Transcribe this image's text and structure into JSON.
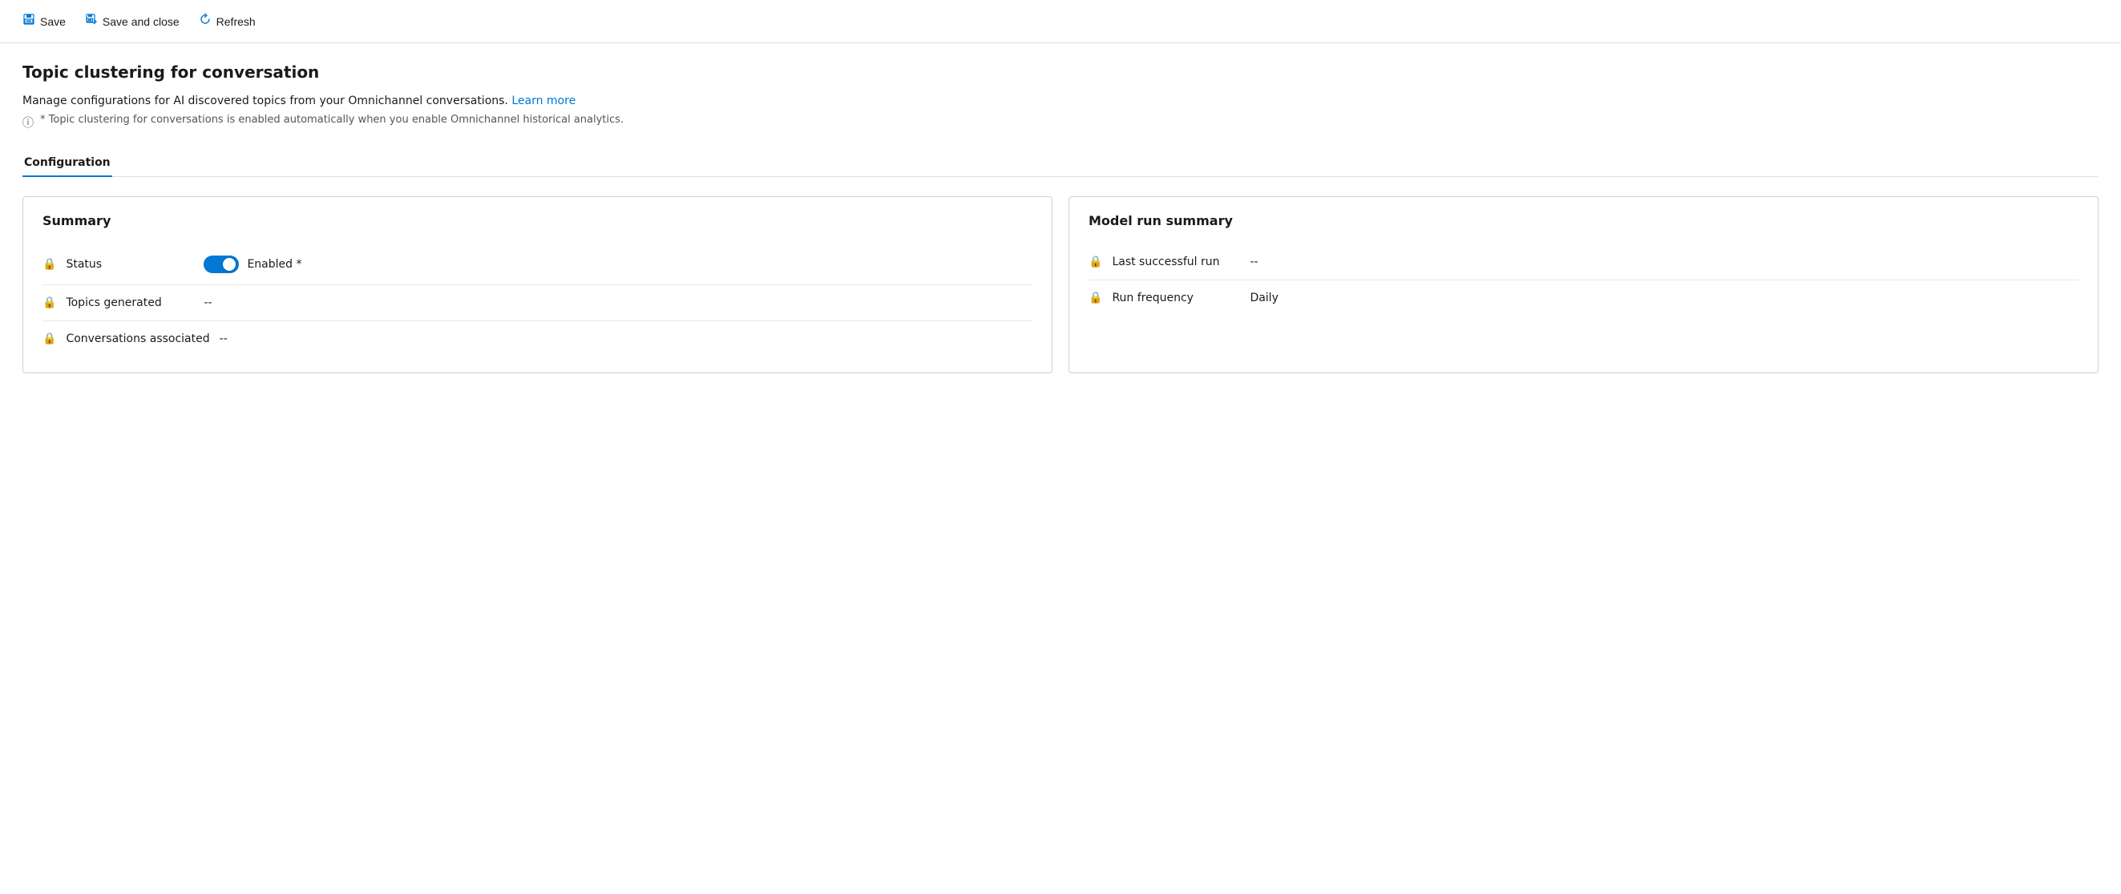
{
  "toolbar": {
    "save_label": "Save",
    "save_close_label": "Save and close",
    "refresh_label": "Refresh"
  },
  "page": {
    "title": "Topic clustering for conversation",
    "description": "Manage configurations for AI discovered topics from your Omnichannel conversations.",
    "learn_more_label": "Learn more",
    "info_note": "* Topic clustering for conversations is enabled automatically when you enable Omnichannel historical analytics."
  },
  "tabs": [
    {
      "label": "Configuration"
    }
  ],
  "summary_card": {
    "title": "Summary",
    "fields": [
      {
        "label": "Status",
        "type": "toggle",
        "value": "Enabled *"
      },
      {
        "label": "Topics generated",
        "value": "--"
      },
      {
        "label": "Conversations associated",
        "value": "--"
      }
    ]
  },
  "model_run_card": {
    "title": "Model run summary",
    "fields": [
      {
        "label": "Last successful run",
        "value": "--"
      },
      {
        "label": "Run frequency",
        "value": "Daily"
      }
    ]
  }
}
